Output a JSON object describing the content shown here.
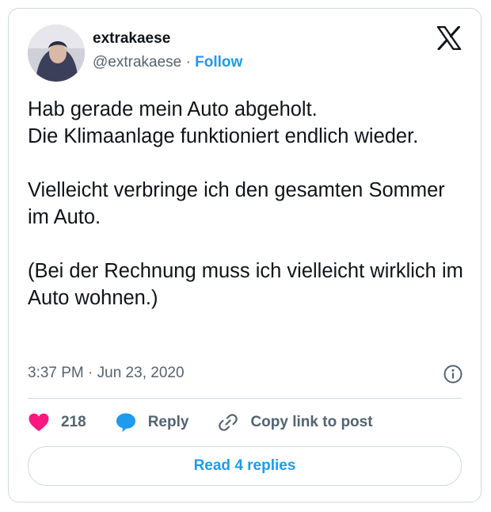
{
  "author": {
    "display_name": "extrakaese",
    "handle": "@extrakaese",
    "separator": "·",
    "follow_label": "Follow"
  },
  "tweet": {
    "paragraphs": [
      [
        "Hab gerade mein Auto abgeholt.",
        "Die Klimaanlage funktioniert endlich wieder."
      ],
      [
        "Vielleicht verbringe ich den gesamten Sommer im Auto."
      ],
      [
        "(Bei der Rechnung muss ich vielleicht wirklich im Auto wohnen.)"
      ]
    ],
    "timestamp": "3:37 PM · Jun 23, 2020"
  },
  "actions": {
    "like_count": "218",
    "reply_label": "Reply",
    "copy_link_label": "Copy link to post"
  },
  "read_replies_label": "Read 4 replies",
  "icons": {
    "logo": "x-logo-icon",
    "info": "info-icon",
    "like": "heart-icon",
    "reply": "speech-bubble-icon",
    "copy": "link-icon"
  },
  "colors": {
    "accent": "#1d9bf0",
    "like": "#f91880",
    "text": "#0f1419",
    "secondary": "#536471",
    "border": "#cfd9de"
  }
}
